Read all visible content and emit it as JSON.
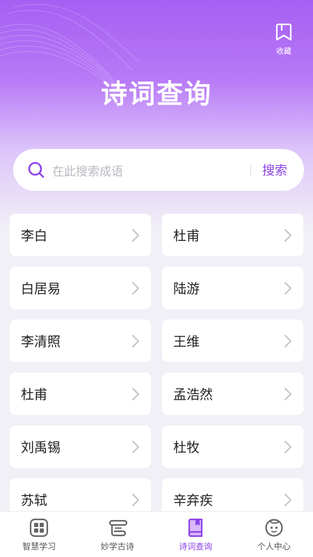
{
  "header": {
    "title": "诗词查询",
    "collect_label": "收藏",
    "collect_icon": "bookmark-icon"
  },
  "search": {
    "placeholder": "在此搜索成语",
    "button_label": "搜索"
  },
  "poets": [
    {
      "name": "李白"
    },
    {
      "name": "杜甫"
    },
    {
      "name": "白居易"
    },
    {
      "name": "陆游"
    },
    {
      "name": "李清照"
    },
    {
      "name": "王维"
    },
    {
      "name": "杜甫"
    },
    {
      "name": "孟浩然"
    },
    {
      "name": "刘禹锡"
    },
    {
      "name": "杜牧"
    },
    {
      "name": "苏轼"
    },
    {
      "name": "辛弃疾"
    }
  ],
  "tabs": [
    {
      "label": "智慧学习",
      "icon": "grid-icon",
      "active": false
    },
    {
      "label": "妙学古诗",
      "icon": "scroll-icon",
      "active": false
    },
    {
      "label": "诗词查询",
      "icon": "book-icon",
      "active": true
    },
    {
      "label": "个人中心",
      "icon": "face-icon",
      "active": false
    }
  ],
  "colors": {
    "accent": "#8d43e6",
    "header_gradient_top": "#a560f3",
    "background": "#f1f0f6"
  }
}
